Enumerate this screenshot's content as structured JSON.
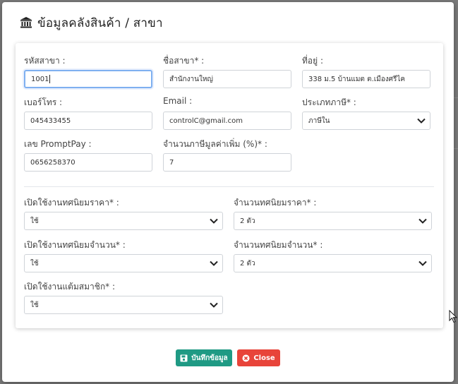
{
  "modal": {
    "title": "ข้อมูลคลังสินค้า / สาขา",
    "title_icon": "bank-icon"
  },
  "form": {
    "branch_code": {
      "label": "รหัสสาขา :",
      "value": "1001"
    },
    "branch_name": {
      "label": "ชื่อสาขา* :",
      "value": "สำนักงานใหญ่"
    },
    "address": {
      "label": "ที่อยู่ :",
      "value": "338 ม.5 บ้านแมต  ต.เมืองศรีไค"
    },
    "phone": {
      "label": "เบอร์โทร :",
      "value": "045433455"
    },
    "email": {
      "label": "Email :",
      "value": "controlC@gmail.com"
    },
    "tax_type": {
      "label": "ประเภทภาษี* :",
      "value": "ภาษีใน"
    },
    "promptpay": {
      "label": "เลข PromptPay :",
      "value": "0656258370"
    },
    "vat_rate": {
      "label": "จำนวนภาษีมูลค่าเพิ่ม (%)* :",
      "value": "7"
    },
    "price_decimal_enabled": {
      "label": "เปิดใช้งานทศนิยมราคา* :",
      "value": "ใช้"
    },
    "price_decimal_places": {
      "label": "จำนวนทศนิยมราคา* :",
      "value": "2 ตัว"
    },
    "qty_decimal_enabled": {
      "label": "เปิดใช้งานทศนิยมจำนวน* :",
      "value": "ใช้"
    },
    "qty_decimal_places": {
      "label": "จำนวนทศนิยมจำนวน* :",
      "value": "2 ตัว"
    },
    "member_points_enabled": {
      "label": "เปิดใช้งานแต้มสมาชิก* :",
      "value": "ใช้"
    }
  },
  "buttons": {
    "save_label": "บันทึกข้อมูล",
    "close_label": "Close"
  },
  "colors": {
    "save": "#1f9a84",
    "close": "#e8443a",
    "focus": "#7fb0f0"
  }
}
